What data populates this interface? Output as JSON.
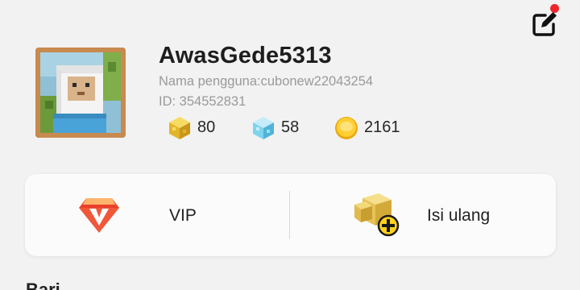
{
  "profile": {
    "username": "AwasGede5313",
    "nickname_line": "Nama pengguna:cubonew22043254",
    "id_line": "ID: 354552831"
  },
  "currencies": [
    {
      "name": "gold-cube",
      "value": "80"
    },
    {
      "name": "diamond-cube",
      "value": "58"
    },
    {
      "name": "coin",
      "value": "2161"
    }
  ],
  "actions": {
    "vip_label": "VIP",
    "topup_label": "Isi ulang"
  },
  "section": {
    "peek_label": "Bari"
  },
  "header": {
    "has_notification": true
  },
  "colors": {
    "background": "#f2f2f2",
    "card": "#fbfbfb",
    "notification_dot": "#f0252b",
    "vip_accent": "#e8402a",
    "gold": "#e6b827",
    "diamond": "#7ed3ee"
  },
  "icons": {
    "edit": "edit-profile-icon",
    "vip": "vip-diamond-icon",
    "topup": "topup-plus-icon"
  }
}
